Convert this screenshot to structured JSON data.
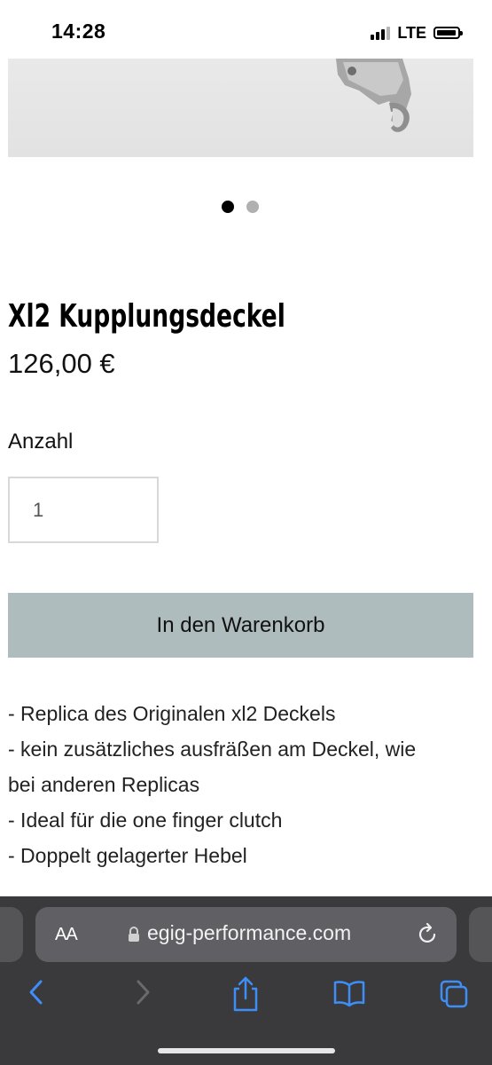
{
  "status_bar": {
    "time": "14:28",
    "network": "LTE"
  },
  "carousel": {
    "total_slides": 2,
    "active_slide": 1
  },
  "product": {
    "title": "Xl2 Kupplungsdeckel",
    "price": "126,00 €",
    "quantity_label": "Anzahl",
    "quantity_value": "1",
    "add_to_cart_label": "In den Warenkorb",
    "description": [
      "- Replica des Originalen xl2 Deckels",
      "- kein zusätzliches ausfräßen am Deckel, wie",
      "bei anderen Replicas",
      "- Ideal für die one finger clutch",
      "- Doppelt gelagerter Hebel"
    ]
  },
  "browser": {
    "text_size_label": "AA",
    "url": "egig-performance.com",
    "accent_color": "#3e8ef7",
    "icons": [
      "back-icon",
      "forward-icon",
      "share-icon",
      "bookmarks-icon",
      "tabs-icon",
      "reload-icon",
      "lock-icon"
    ]
  }
}
